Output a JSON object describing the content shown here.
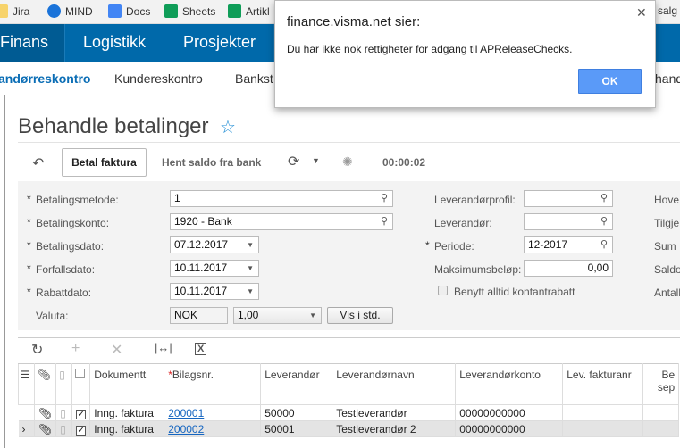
{
  "bookmarks": [
    {
      "label": "Jira",
      "color": "#f7d36b"
    },
    {
      "label": "MIND",
      "color": "#1a73d9"
    },
    {
      "label": "Docs",
      "color": "#4285f4"
    },
    {
      "label": "Sheets",
      "color": "#0f9d58"
    },
    {
      "label": "Artikl",
      "color": "#0f9d58"
    },
    {
      "label": "salg"
    }
  ],
  "nav": {
    "items": [
      "Finans",
      "Logistikk",
      "Prosjekter"
    ]
  },
  "subnav": {
    "items": [
      "andørreskontro",
      "Kundereskontro",
      "Bankst",
      "hand"
    ]
  },
  "page": {
    "title": "Behandle betalinger"
  },
  "toolbar": {
    "betal": "Betal faktura",
    "hent": "Hent saldo fra bank",
    "timer": "00:00:02"
  },
  "form": {
    "left": [
      {
        "label": "Betalingsmetode:",
        "value": "1",
        "required": true,
        "icon": "search"
      },
      {
        "label": "Betalingskonto:",
        "value": "1920 - Bank",
        "required": true,
        "icon": "search"
      },
      {
        "label": "Betalingsdato:",
        "value": "07.12.2017",
        "required": true,
        "icon": "dropdown"
      },
      {
        "label": "Forfallsdato:",
        "value": "10.11.2017",
        "required": true,
        "icon": "dropdown"
      },
      {
        "label": "Rabattdato:",
        "value": "10.11.2017",
        "required": true,
        "icon": "dropdown"
      }
    ],
    "valuta": {
      "label": "Valuta:",
      "currency": "NOK",
      "rate": "1,00",
      "button": "Vis i std."
    },
    "mid": [
      {
        "label": "Leverandørprofil:",
        "value": ""
      },
      {
        "label": "Leverandør:",
        "value": ""
      },
      {
        "label": "Periode:",
        "value": "12-2017",
        "required": true
      },
      {
        "label": "Maksimumsbeløp:",
        "value": "0,00"
      }
    ],
    "checkbox": "Benytt alltid kontantrabatt",
    "right": [
      "Hove",
      "Tilgje",
      "Sum",
      "Saldo",
      "Antall"
    ]
  },
  "grid": {
    "headers": [
      "Dokumentt",
      "Bilagsnr.",
      "Leverandør",
      "Leverandørnavn",
      "Leverandørkonto",
      "Lev. fakturanr",
      "Be sep"
    ],
    "rows": [
      {
        "type": "Inng. faktura",
        "bilag": "200001",
        "lev": "50000",
        "navn": "Testleverandør",
        "konto": "00000000000",
        "checked": true
      },
      {
        "type": "Inng. faktura",
        "bilag": "200002",
        "lev": "50001",
        "navn": "Testleverandør 2",
        "konto": "00000000000",
        "checked": true
      }
    ]
  },
  "dialog": {
    "title": "finance.visma.net sier:",
    "message": "Du har ikke nok rettigheter for adgang til APReleaseChecks.",
    "ok": "OK"
  }
}
